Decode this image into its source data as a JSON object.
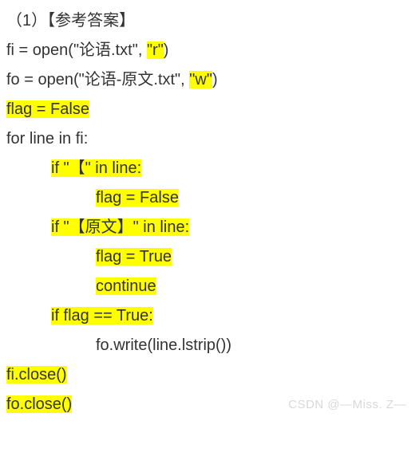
{
  "header": "（1）【参考答案】",
  "code": {
    "l1_a": "fi = open(\"论语.txt\", ",
    "l1_b": "\"r\"",
    "l1_c": ")",
    "l2_a": "fo = open(\"论语-原文.txt\", ",
    "l2_b": "\"w\"",
    "l2_c": ")",
    "l3": "flag = False",
    "l4": "for line in fi:",
    "l5": "if \"【\" in line:",
    "l6": "flag = False",
    "l7": "if \"【原文】\" in line:",
    "l8": "flag = True",
    "l9": "continue",
    "l10": "if flag == True:",
    "l11": "fo.write(line.lstrip())",
    "l12": "fi.close()",
    "l13": "fo.close()"
  },
  "watermark": "CSDN @—Miss. Z—"
}
